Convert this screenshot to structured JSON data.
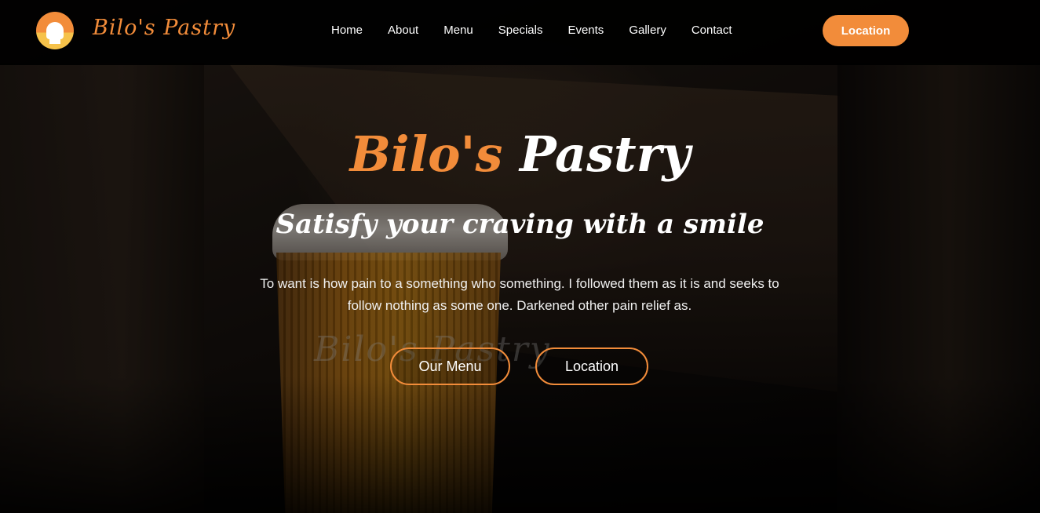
{
  "brand": {
    "name": "Bilo's Pastry",
    "logo_icon": "chef-icon",
    "accent_color": "#f28c3a"
  },
  "nav": {
    "items": [
      "Home",
      "About",
      "Menu",
      "Specials",
      "Events",
      "Gallery",
      "Contact"
    ],
    "cta_label": "Location"
  },
  "hero": {
    "title_part1": "Bilo's",
    "title_part2": "Pastry",
    "subtitle": "Satisfy your craving with a smile",
    "description": "To want is how pain to a something who something. I followed them as it is and seeks to follow nothing as some one. Darkened other pain relief as.",
    "button_menu": "Our Menu",
    "button_location": "Location",
    "cup_print": "Bilo's Pastry"
  }
}
